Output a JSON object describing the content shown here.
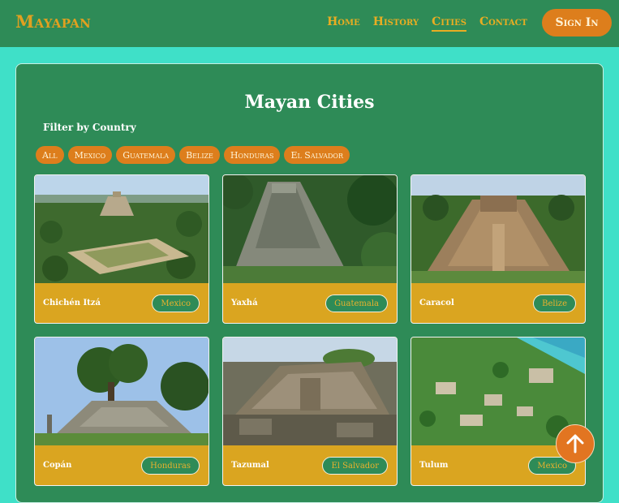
{
  "header": {
    "logo": "Mayapan",
    "nav": [
      "Home",
      "History",
      "Cities",
      "Contact"
    ],
    "active_nav": "Cities",
    "signin_label": "Sign In"
  },
  "main": {
    "title": "Mayan Cities",
    "filter_label": "Filter by Country",
    "filters": [
      "All",
      "Mexico",
      "Guatemala",
      "Belize",
      "Honduras",
      "El Salvador"
    ]
  },
  "cards": [
    {
      "name": "Chichén Itzá",
      "country": "Mexico"
    },
    {
      "name": "Yaxhá",
      "country": "Guatemala"
    },
    {
      "name": "Caracol",
      "country": "Belize"
    },
    {
      "name": "Copán",
      "country": "Honduras"
    },
    {
      "name": "Tazumal",
      "country": "El Salvador"
    },
    {
      "name": "Tulum",
      "country": "Mexico"
    }
  ],
  "colors": {
    "nav_bg": "#2e8b57",
    "page_bg": "#3fe0c8",
    "accent_orange": "#dd7e1c",
    "card_gold": "#daa520",
    "gold_text": "#e9ad22"
  },
  "icons": {
    "scroll_top": "arrow-up-icon"
  }
}
